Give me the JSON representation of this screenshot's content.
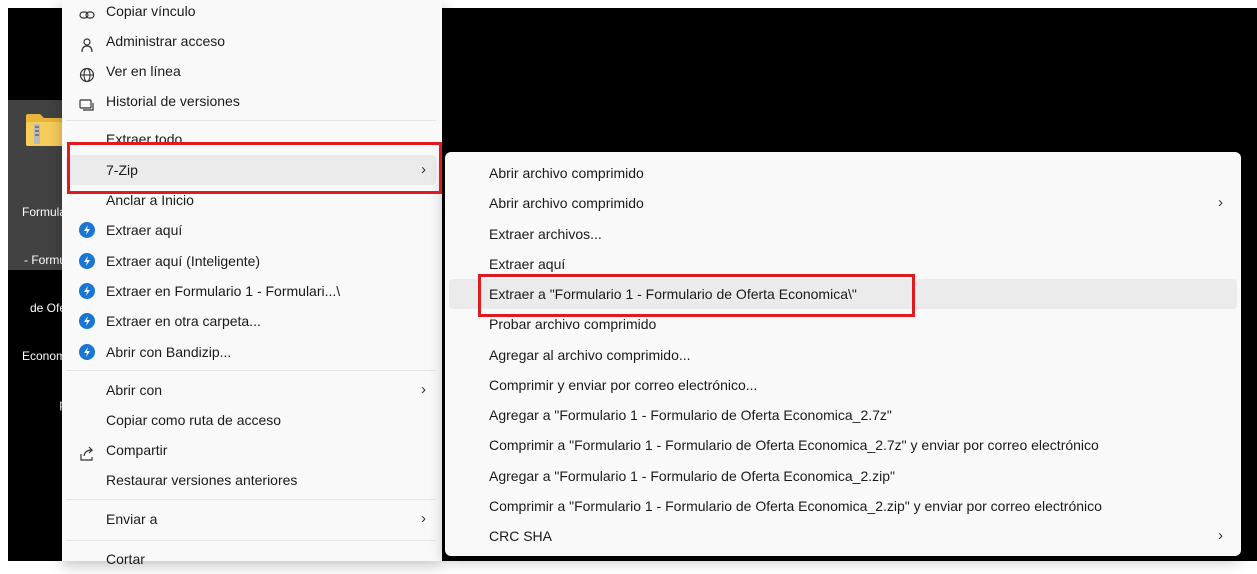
{
  "desktop_file": {
    "name_lines": [
      "Formula",
      "- Formu",
      "de Ofe",
      "Econom",
      "p"
    ]
  },
  "context_menu": {
    "items": [
      {
        "label": "Copiar vínculo",
        "icon": "link-icon"
      },
      {
        "label": "Administrar acceso",
        "icon": "user-icon"
      },
      {
        "label": "Ver en línea",
        "icon": "globe-icon"
      },
      {
        "label": "Historial de versiones",
        "icon": "history-icon"
      },
      {
        "label": "Extraer todo",
        "icon": ""
      },
      {
        "label": "7-Zip",
        "icon": "",
        "has_submenu": true
      },
      {
        "label": "Anclar a Inicio",
        "icon": ""
      },
      {
        "label": "Extraer aquí",
        "icon": "bandizip-icon"
      },
      {
        "label": "Extraer aquí (Inteligente)",
        "icon": "bandizip-icon"
      },
      {
        "label": "Extraer en Formulario 1 - Formulari...\\",
        "icon": "bandizip-icon"
      },
      {
        "label": "Extraer en otra carpeta...",
        "icon": "bandizip-icon"
      },
      {
        "label": "Abrir con Bandizip...",
        "icon": "bandizip-icon"
      },
      {
        "label": "Abrir con",
        "icon": "",
        "has_submenu": true
      },
      {
        "label": "Copiar como ruta de acceso",
        "icon": ""
      },
      {
        "label": "Compartir",
        "icon": "share-icon"
      },
      {
        "label": "Restaurar versiones anteriores",
        "icon": ""
      },
      {
        "label": "Enviar a",
        "icon": "",
        "has_submenu": true
      },
      {
        "label": "Cortar",
        "icon": ""
      }
    ],
    "arrow": "›"
  },
  "submenu_7zip": {
    "items": [
      {
        "label": "Abrir archivo comprimido"
      },
      {
        "label": "Abrir archivo comprimido",
        "has_submenu": true
      },
      {
        "label": "Extraer archivos..."
      },
      {
        "label": "Extraer aquí"
      },
      {
        "label": "Extraer a \"Formulario 1 - Formulario de Oferta Economica\\\""
      },
      {
        "label": "Probar archivo comprimido"
      },
      {
        "label": "Agregar al archivo comprimido..."
      },
      {
        "label": "Comprimir y enviar por correo electrónico..."
      },
      {
        "label": "Agregar a \"Formulario 1 - Formulario de Oferta Economica_2.7z\""
      },
      {
        "label": "Comprimir a \"Formulario 1 - Formulario de Oferta Economica_2.7z\" y enviar por correo electrónico"
      },
      {
        "label": "Agregar a \"Formulario 1 - Formulario de Oferta Economica_2.zip\""
      },
      {
        "label": "Comprimir a \"Formulario 1 - Formulario de Oferta Economica_2.zip\" y enviar por correo electrónico"
      },
      {
        "label": "CRC SHA",
        "has_submenu": true
      }
    ]
  },
  "colors": {
    "highlight_box": "#e11a1f",
    "menu_bg": "#f9f9f9",
    "hover_bg": "#ebebeb",
    "bandizip_blue": "#1976d2",
    "folder_yellow": "#f4c542"
  }
}
